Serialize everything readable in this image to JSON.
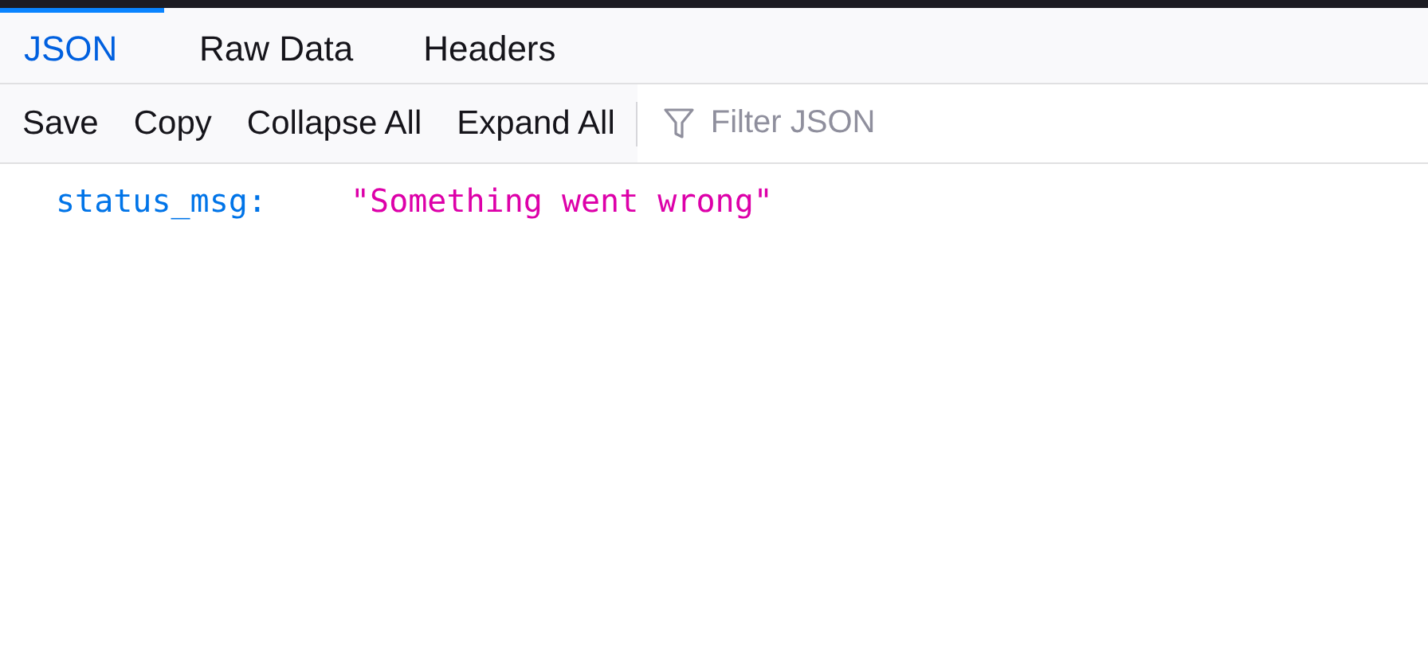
{
  "tabs": [
    {
      "label": "JSON",
      "selected": true
    },
    {
      "label": "Raw Data",
      "selected": false
    },
    {
      "label": "Headers",
      "selected": false
    }
  ],
  "toolbar": {
    "buttons": [
      "Save",
      "Copy",
      "Collapse All",
      "Expand All"
    ],
    "filter": {
      "placeholder": "Filter JSON"
    }
  },
  "rows": [
    {
      "key": "status_msg:",
      "value": "\"Something went wrong\""
    }
  ]
}
